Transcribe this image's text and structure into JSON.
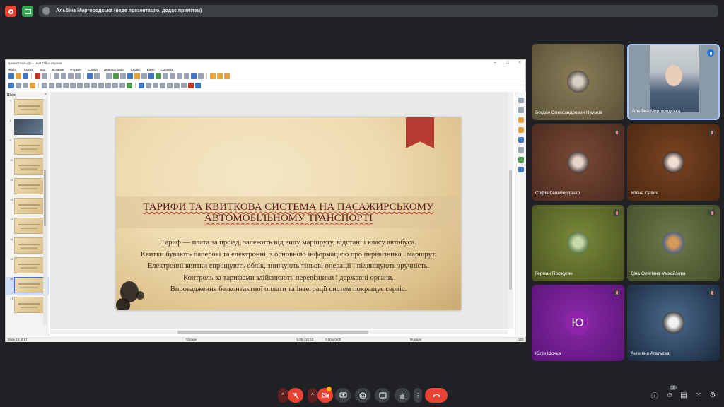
{
  "top": {
    "presenter_text": "Альбіна Миргородська (веде презентацію, додає примітки)"
  },
  "app": {
    "window_title": "презентація.odp - Neat Office Impress",
    "menu": [
      "Файл",
      "Правка",
      "Вид",
      "Вставка",
      "Формат",
      "Слайд",
      "Демонстрація",
      "Сервіс",
      "Вікно",
      "Справка"
    ],
    "panel_title": "Slide",
    "thumbnails": [
      "7",
      "8",
      "9",
      "10",
      "11",
      "12",
      "13",
      "14",
      "15",
      "16",
      "17"
    ],
    "selected_slide": "16",
    "statusbar": {
      "slide_counter": "Slide 16 of 17",
      "theme": "Vintage",
      "position": "-1,85 / 10,63",
      "size": "0,00 x 0,00",
      "language": "Russian",
      "zoom": "120 %"
    }
  },
  "slide": {
    "title": "ТАРИФИ ТА КВИТКОВА СИСТЕМА НА ПАСАЖИРСЬКОМУ АВТОМОБІЛЬНОМУ ТРАНСПОРТІ",
    "bullets": [
      "Тариф — плата за проїзд, залежить від виду маршруту, відстані і класу автобуса.",
      "Квитки бувають паперові та електронні, з основною інформацією про перевізника і маршрут.",
      "Електронні квитки спрощують облік, знижують тіньові операції і підвищують зручність.",
      "Контроль за тарифами здійснюють перевізники і державні органи.",
      "Впровадження безконтактної оплати та інтеграції систем покращує сервіс."
    ]
  },
  "participants": [
    {
      "name": "Богдан Олександрович Наумов",
      "bg": "#6e6448",
      "mic": "none"
    },
    {
      "name": "Альбіна Миргородська",
      "bg": "#7a8a96",
      "mic": "speaking"
    },
    {
      "name": "Софія Келеберденко",
      "bg": "#5b3526",
      "mic": "muted"
    },
    {
      "name": "Уляна Савич",
      "bg": "#5a3218",
      "mic": "muted"
    },
    {
      "name": "Герман Прожуган",
      "bg": "#5c6a2a",
      "mic": "muted"
    },
    {
      "name": "Діна Олегівна Михайлова",
      "bg": "#55603a",
      "mic": "muted"
    },
    {
      "name": "Юлія Щочка",
      "bg": "#6a1b8a",
      "mic": "muted",
      "initial": "Ю"
    },
    {
      "name": "Ангеліна Агатьєва",
      "bg": "#1f3550",
      "mic": "muted"
    }
  ],
  "controls": {
    "participants_count": "10"
  }
}
